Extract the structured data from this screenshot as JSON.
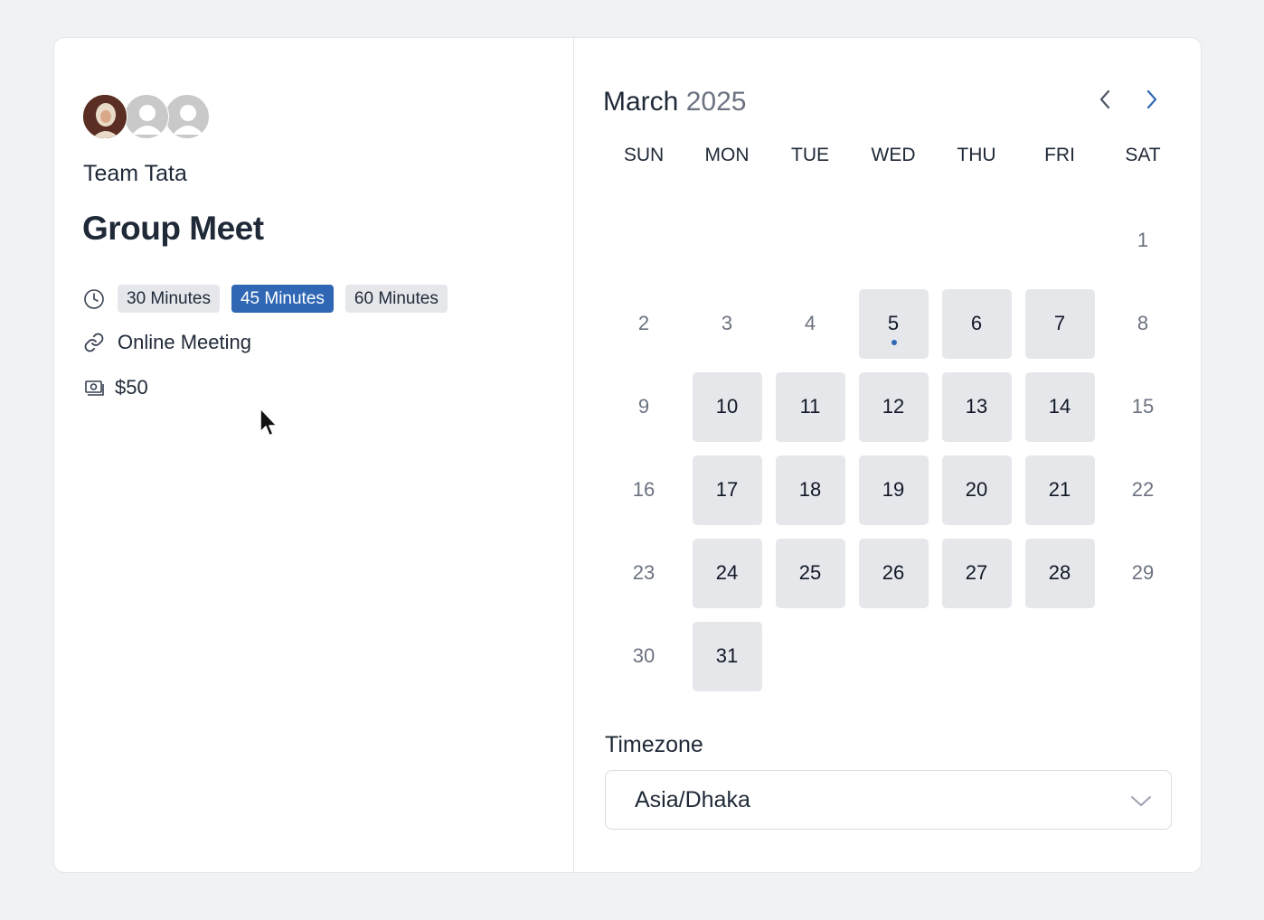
{
  "team": {
    "name": "Team Tata"
  },
  "event": {
    "title": "Group Meet",
    "durations": [
      {
        "label": "30 Minutes",
        "selected": false
      },
      {
        "label": "45 Minutes",
        "selected": true
      },
      {
        "label": "60 Minutes",
        "selected": false
      }
    ],
    "location": "Online Meeting",
    "price": "$50"
  },
  "calendar": {
    "month": "March",
    "year": "2025",
    "weekdays": [
      "SUN",
      "MON",
      "TUE",
      "WED",
      "THU",
      "FRI",
      "SAT"
    ],
    "days": [
      {
        "d": "",
        "a": false
      },
      {
        "d": "",
        "a": false
      },
      {
        "d": "",
        "a": false
      },
      {
        "d": "",
        "a": false
      },
      {
        "d": "",
        "a": false
      },
      {
        "d": "",
        "a": false
      },
      {
        "d": "1",
        "a": false
      },
      {
        "d": "2",
        "a": false
      },
      {
        "d": "3",
        "a": false
      },
      {
        "d": "4",
        "a": false
      },
      {
        "d": "5",
        "a": true,
        "today": true
      },
      {
        "d": "6",
        "a": true
      },
      {
        "d": "7",
        "a": true
      },
      {
        "d": "8",
        "a": false
      },
      {
        "d": "9",
        "a": false
      },
      {
        "d": "10",
        "a": true
      },
      {
        "d": "11",
        "a": true
      },
      {
        "d": "12",
        "a": true
      },
      {
        "d": "13",
        "a": true
      },
      {
        "d": "14",
        "a": true
      },
      {
        "d": "15",
        "a": false
      },
      {
        "d": "16",
        "a": false
      },
      {
        "d": "17",
        "a": true
      },
      {
        "d": "18",
        "a": true
      },
      {
        "d": "19",
        "a": true
      },
      {
        "d": "20",
        "a": true
      },
      {
        "d": "21",
        "a": true
      },
      {
        "d": "22",
        "a": false
      },
      {
        "d": "23",
        "a": false
      },
      {
        "d": "24",
        "a": true
      },
      {
        "d": "25",
        "a": true
      },
      {
        "d": "26",
        "a": true
      },
      {
        "d": "27",
        "a": true
      },
      {
        "d": "28",
        "a": true
      },
      {
        "d": "29",
        "a": false
      },
      {
        "d": "30",
        "a": false
      },
      {
        "d": "31",
        "a": true
      }
    ]
  },
  "timezone": {
    "label": "Timezone",
    "value": "Asia/Dhaka"
  },
  "colors": {
    "accent": "#2f67b4",
    "chip_bg": "#e5e7eb",
    "available_bg": "#e5e7eb"
  },
  "icons": [
    "clock-icon",
    "link-icon",
    "money-icon",
    "chevron-left-icon",
    "chevron-right-icon",
    "chevron-down-icon"
  ]
}
